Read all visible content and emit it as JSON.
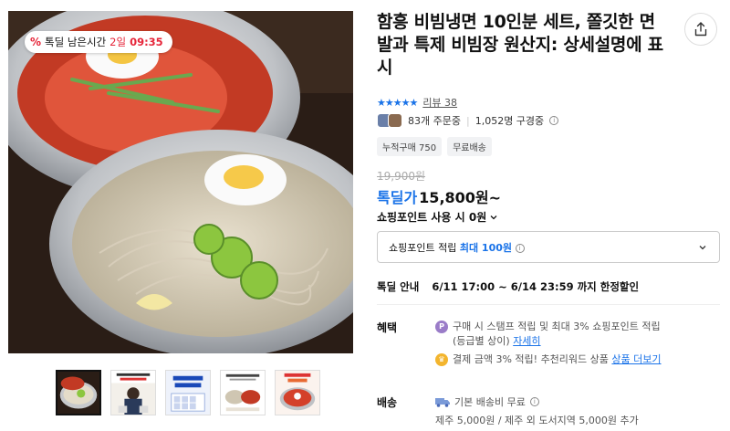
{
  "product": {
    "title": "함흥 비빔냉면 10인분 세트, 쫄깃한 면발과 특제 비빔장 원산지: 상세설명에 표시",
    "timer": {
      "prefix": "%",
      "label": "톡딜 남은시간",
      "days": "2일",
      "time": "09:35"
    },
    "rating": {
      "stars": "★★★★★",
      "review_text": "리뷰 38"
    },
    "buyers": {
      "orders": "83개 주문중",
      "separator": "|",
      "subscribers": "1,052명 구경중"
    },
    "chips": [
      "누적구매 750",
      "무료배송"
    ],
    "original_price": "19,900원",
    "sale_label": "톡딜가",
    "sale_price": "15,800원~",
    "point_use": "쇼핑포인트 사용 시 0원",
    "point_box": {
      "prefix": "쇼핑포인트 적립",
      "max": "최대 100원"
    },
    "deal": {
      "label": "톡딜 안내",
      "text": "6/11 17:00 ~ 6/14 23:59 까지 한정할인"
    },
    "benefit": {
      "label": "혜택",
      "line1": "구매 시 스탬프 적립 및 최대 3% 쇼핑포인트 적립",
      "line1b": "(등급별 상이)",
      "line1_link": "자세히",
      "line2": "결제 금액 3% 적립! 추천리워드 상품",
      "line2_link": "상품 더보기"
    },
    "shipping": {
      "label": "배송",
      "line1": "기본 배송비 무료",
      "line2": "제주 5,000원 / 제주 외 도서지역 5,000원 추가"
    }
  },
  "thumbnails": [
    {
      "name": "noodle-bowl",
      "text": ""
    },
    {
      "name": "person-promo",
      "text": ""
    },
    {
      "name": "ten-servings",
      "text": "10인분이\n1만 원대!"
    },
    {
      "name": "recipe-card",
      "text": ""
    },
    {
      "name": "spicy-noodle",
      "text": ""
    }
  ],
  "colors": {
    "accent_blue": "#1a73e8",
    "timer_red": "#e6263a"
  }
}
